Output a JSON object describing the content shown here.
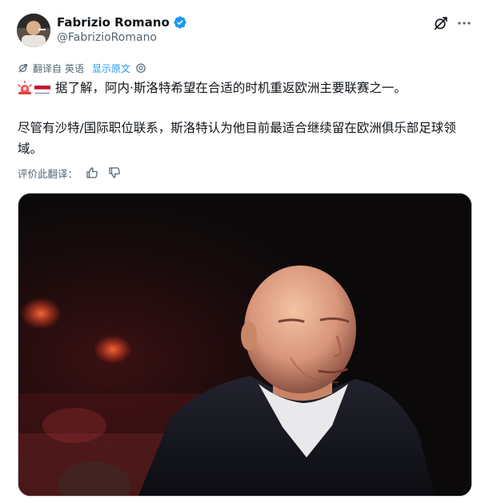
{
  "author": {
    "display_name": "Fabrizio Romano",
    "handle": "@FabrizioRomano"
  },
  "translation": {
    "label_prefix": "翻译自",
    "language": "英语",
    "show_original": "显示原文"
  },
  "tweet": {
    "line1": "据了解，阿内·斯洛特希望在合适的时机重返欧洲主要联赛之一。",
    "line2": "尽管有沙特/国际职位联系，斯洛特认为他目前最适合继续留在欧洲俱乐部足球领域。"
  },
  "rate": {
    "label": "评价此翻译："
  },
  "icons": {
    "verified": "verified-badge-icon",
    "grok": "grok-icon",
    "more": "more-icon",
    "translate": "translate-icon",
    "settings": "gear-icon",
    "thumbs_up": "thumbs-up-icon",
    "thumbs_down": "thumbs-down-icon",
    "siren": "rotating-light-emoji",
    "flag": "netherlands-flag-emoji"
  },
  "colors": {
    "link": "#1d9bf0",
    "verified": "#1d9bf0",
    "muted": "#536471",
    "text": "#0f1419"
  }
}
